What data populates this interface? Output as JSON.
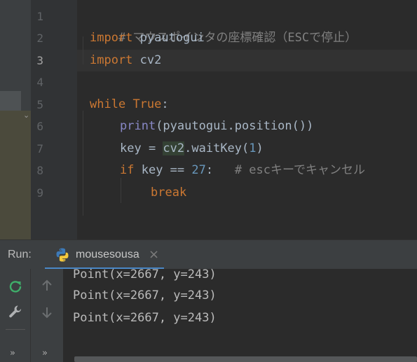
{
  "editor": {
    "line_numbers": [
      "1",
      "2",
      "3",
      "4",
      "5",
      "6",
      "7",
      "8",
      "9"
    ],
    "active_line": "3",
    "lines": [
      {
        "comment": "# マウスポインタの座標確認（ESCで停止）"
      },
      {
        "kw": "import",
        "rest": " pyautogui"
      },
      {
        "kw": "import",
        "rest": " cv2"
      },
      {},
      {
        "kw": "while",
        "kw2": "True",
        "colon": ":"
      },
      {
        "fn": "print",
        "rest": "(pyautogui.position())"
      },
      {
        "a": "key = ",
        "hl": "cv2",
        "b": ".waitKey(",
        "num": "1",
        "c": ")"
      },
      {
        "kw": "if",
        "a": " key == ",
        "num": "27",
        "c": ":   ",
        "comment": "# escキーでキャンセル"
      },
      {
        "kw": "break"
      }
    ]
  },
  "run_panel": {
    "label": "Run:",
    "tab_name": "mousesousa",
    "close_glyph": "×",
    "output": [
      "Point(x=2667, y=243)",
      "Point(x=2667, y=243)",
      "Point(x=2667, y=243)"
    ],
    "icons": {
      "rerun": "rerun-icon",
      "settings": "wrench-icon",
      "up": "arrow-up-icon",
      "down": "arrow-down-icon",
      "more": "»"
    }
  },
  "colors": {
    "background": "#2b2b2b",
    "keyword": "#cc7832",
    "builtin": "#8888c6",
    "number": "#6897bb",
    "comment": "#808080",
    "tab_underline": "#4a88c7"
  }
}
